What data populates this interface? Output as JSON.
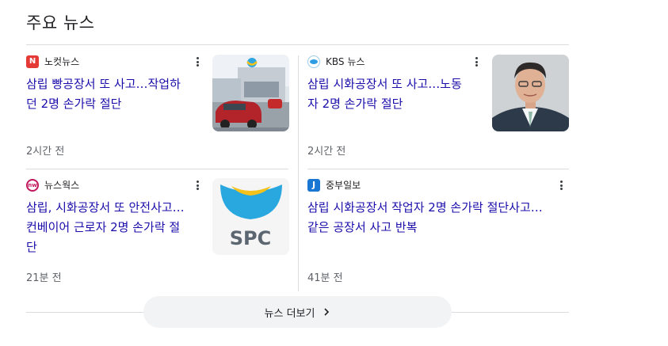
{
  "section": {
    "title": "주요 뉴스"
  },
  "articles": [
    {
      "source": "노컷뉴스",
      "logo_letter": "N",
      "logo_color": "#e53935",
      "headline_line1": "삼립 빵공장서 또 사고…작업하",
      "headline_line2": "던 2명 손가락 절단",
      "time": "2시간 전",
      "thumbnail": "spc-factory-photo"
    },
    {
      "source": "KBS 뉴스",
      "logo_color": "#2f9be1",
      "headline_line1": "삼립 시화공장서 또 사고…노동",
      "headline_line2": "자 2명 손가락 절단",
      "time": "2시간 전",
      "thumbnail": "person-portrait-photo"
    },
    {
      "source": "뉴스웍스",
      "logo_letter": "nw",
      "logo_color": "#c2185b",
      "headline_line1": "삼립, 시화공장서 또 안전사고…",
      "headline_line2": "컨베이어 근로자 2명 손가락 절",
      "headline_line3": "단",
      "time": "21분 전",
      "thumbnail": "spc-logo",
      "thumb_text": "SPC"
    },
    {
      "source": "중부일보",
      "logo_letter": "J",
      "logo_color": "#1976d2",
      "headline_line1": "삼립 시화공장서 작업자 2명 손가락 절단사고…",
      "headline_line2": "같은 공장서 사고 반복",
      "time": "41분 전"
    }
  ],
  "more_button": {
    "label": "뉴스 더보기",
    "icon": "chevron-right-icon"
  }
}
